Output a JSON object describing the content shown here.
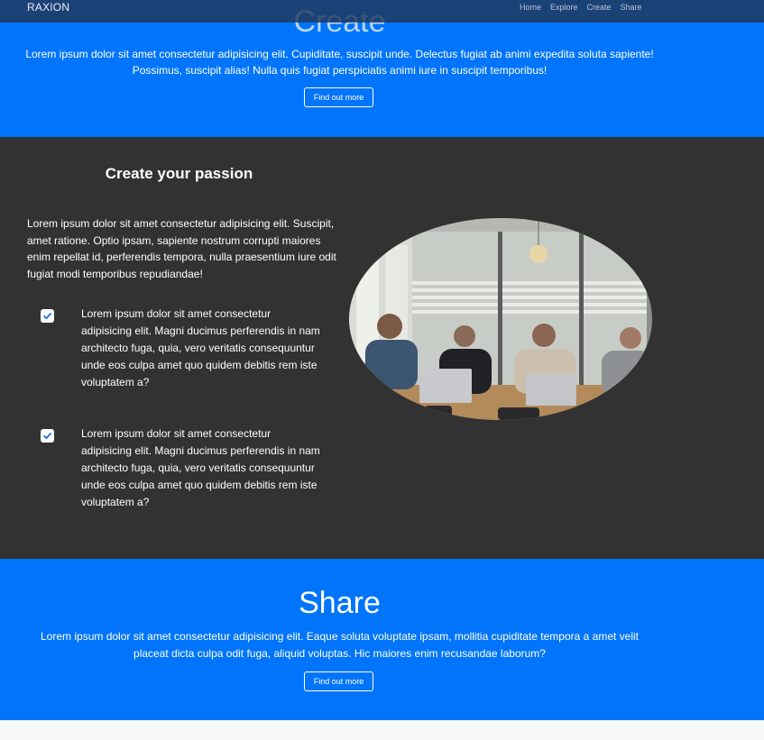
{
  "nav": {
    "brand": "RAXION",
    "links": [
      "Home",
      "Explore",
      "Create",
      "Share"
    ]
  },
  "create": {
    "title": "Create",
    "text_line1": "Lorem ipsum dolor sit amet consectetur adipisicing elit. Cupiditate, suscipit unde. Delectus fugiat ab animi expedita soluta sapiente!",
    "text_line2": "Possimus, suscipit alias! Nulla quis fugiat perspiciatis animi iure in suscipit temporibus!",
    "button": "Find out more"
  },
  "passion": {
    "title": "Create your passion",
    "text": "Lorem ipsum dolor sit amet consectetur adipisicing elit. Suscipit, amet ratione. Optio ipsam, sapiente nostrum corrupti maiores enim repellat id, perferendis tempora, nulla praesentium iure odit fugiat modi temporibus repudiandae!",
    "features": [
      "Lorem ipsum dolor sit amet consectetur adipisicing elit. Magni ducimus perferendis in nam architecto fuga, quia, vero veritatis consequuntur unde eos culpa amet quo quidem debitis rem iste voluptatem a?",
      "Lorem ipsum dolor sit amet consectetur adipisicing elit. Magni ducimus perferendis in nam architecto fuga, quia, vero veritatis consequuntur unde eos culpa amet quo quidem debitis rem iste voluptatem a?"
    ]
  },
  "share": {
    "title": "Share",
    "text_line1": "Lorem ipsum dolor sit amet consectetur adipisicing elit. Eaque soluta voluptate ipsam, mollitia cupiditate tempora a amet velit",
    "text_line2": "placeat dicta culpa odit fuga, aliquid voluptas. Hic maiores enim recusandae laborum?",
    "button": "Find out more"
  },
  "colors": {
    "primary_blue": "#0075fb",
    "dark_section": "#323232",
    "navbar": "#213758"
  },
  "icons": {
    "feature_check": "check-square-icon"
  }
}
